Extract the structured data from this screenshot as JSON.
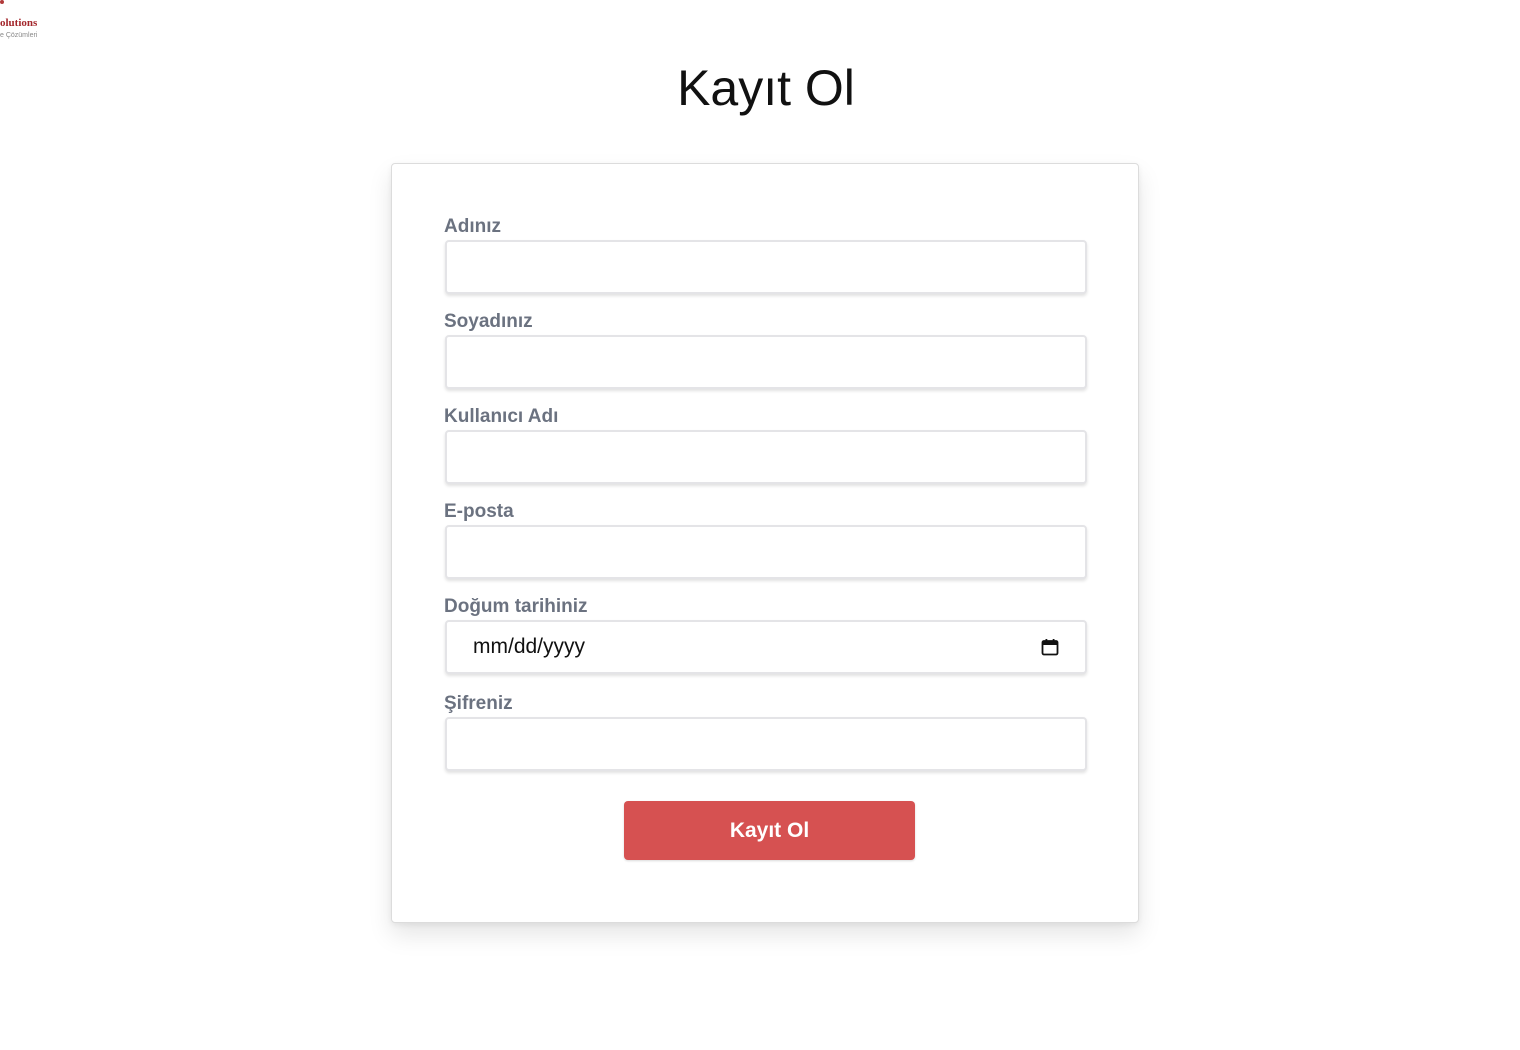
{
  "logo": {
    "name": "olutions",
    "tagline": "e Çözümleri",
    "icon": "company-logo"
  },
  "page": {
    "title": "Kayıt Ol"
  },
  "form": {
    "fields": [
      {
        "label": "Adınız",
        "value": "",
        "placeholder": ""
      },
      {
        "label": "Soyadınız",
        "value": "",
        "placeholder": ""
      },
      {
        "label": "Kullanıcı Adı",
        "value": "",
        "placeholder": ""
      },
      {
        "label": "E-posta",
        "value": "",
        "placeholder": ""
      },
      {
        "label": "Doğum tarihiniz",
        "value": "mm/dd/yyyy",
        "icon": "calendar-icon"
      },
      {
        "label": "Şifreniz",
        "value": "",
        "placeholder": ""
      }
    ],
    "submit_label": "Kayıt Ol"
  },
  "colors": {
    "accent": "#d65151",
    "label": "#6b7280",
    "brand": "#a3262b"
  }
}
